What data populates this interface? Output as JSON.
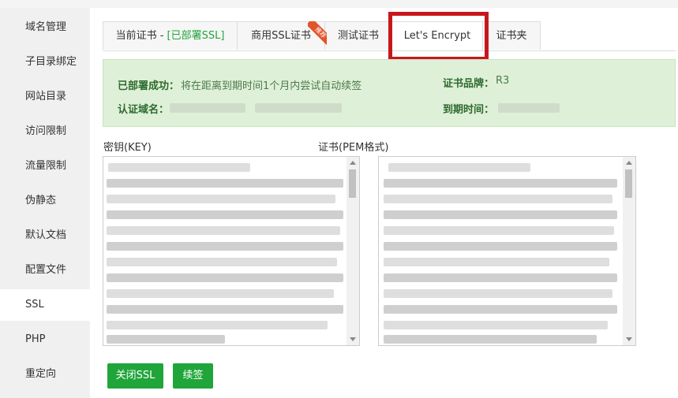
{
  "sidebar": {
    "items": [
      {
        "label": "域名管理"
      },
      {
        "label": "子目录绑定"
      },
      {
        "label": "网站目录"
      },
      {
        "label": "访问限制"
      },
      {
        "label": "流量限制"
      },
      {
        "label": "伪静态"
      },
      {
        "label": "默认文档"
      },
      {
        "label": "配置文件"
      },
      {
        "label": "SSL"
      },
      {
        "label": "PHP"
      },
      {
        "label": "重定向"
      }
    ],
    "active": "SSL"
  },
  "tabs": {
    "current_prefix": "当前证书 - ",
    "current_status": "[已部署SSL]",
    "commercial": "商用SSL证书",
    "commercial_badge": "推荐",
    "test": "测试证书",
    "letsencrypt": "Let's Encrypt",
    "folder": "证书夹",
    "active": "Let's Encrypt"
  },
  "info": {
    "deployed_label": "已部署成功：",
    "deployed_text": "将在距离到期时间1个月内尝试自动续签",
    "brand_label": "证书品牌：",
    "brand_value": "R3",
    "domain_label": "认证域名：",
    "expiry_label": "到期时间："
  },
  "key_label": "密钥(KEY)",
  "cert_label": "证书(PEM格式)",
  "buttons": {
    "close_ssl": "关闭SSL",
    "renew": "续签"
  },
  "colors": {
    "accent_green": "#20a53a",
    "info_bg": "#dff0d8",
    "highlight_red": "#c8171c"
  }
}
